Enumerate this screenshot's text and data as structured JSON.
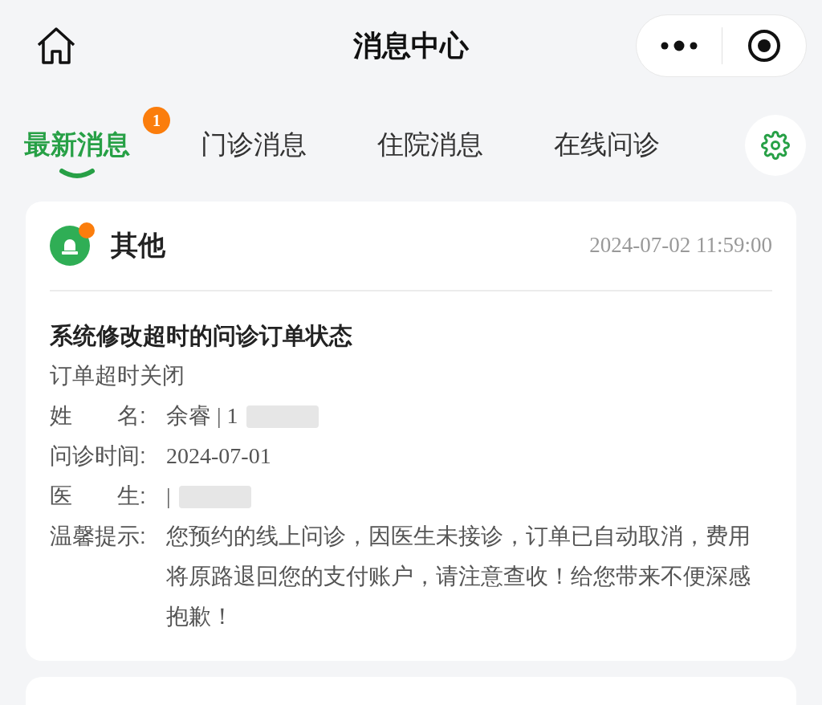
{
  "title": "消息中心",
  "tabs": [
    {
      "label": "最新消息",
      "selected": true,
      "badge": "1"
    },
    {
      "label": "门诊消息",
      "selected": false
    },
    {
      "label": "住院消息",
      "selected": false
    },
    {
      "label": "在线问诊",
      "selected": false
    }
  ],
  "message": {
    "category": "其他",
    "unread": true,
    "time": "2024-07-02 11:59:00",
    "subject": "系统修改超时的问诊订单状态",
    "summary": "订单超时关闭",
    "fields": [
      {
        "label": "姓　　名:",
        "value": "余睿 | 1",
        "redacted": true
      },
      {
        "label": "问诊时间:",
        "value": "2024-07-01",
        "redacted": false
      },
      {
        "label": "医　　生:",
        "value": "|",
        "redacted": true
      },
      {
        "label": "温馨提示:",
        "value": "您预约的线上问诊，因医生未接诊，订单已自动取消，费用将原路退回您的支付账户，请注意查收！给您带来不便深感抱歉！",
        "redacted": false
      }
    ]
  }
}
